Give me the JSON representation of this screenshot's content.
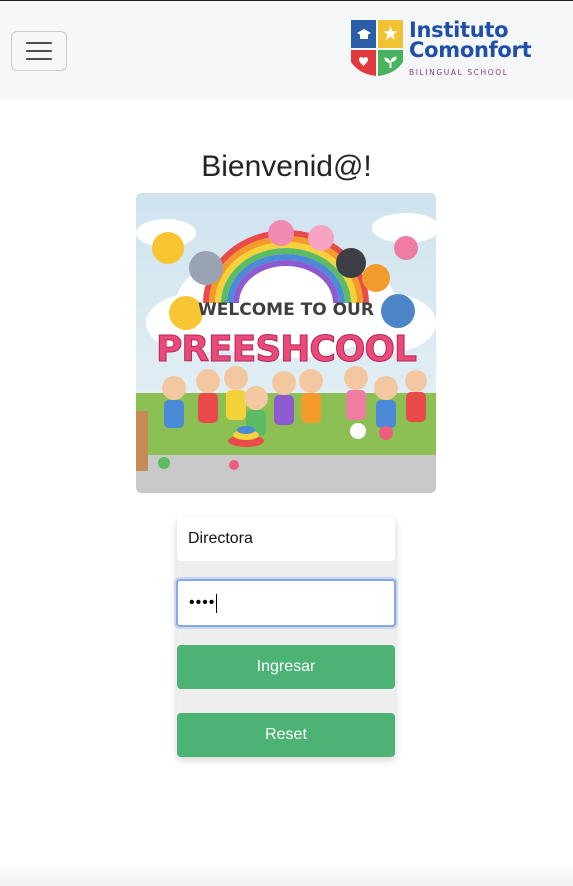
{
  "navbar": {
    "menu_toggle": "hamburger-icon",
    "logo": {
      "line1": "Instituto",
      "line2": "Comonfort",
      "tagline": "BILINGUAL SCHOOL",
      "colors": {
        "blue": "#2a5ea8",
        "yellow": "#f1c232",
        "red": "#e2393f",
        "green": "#47b35c",
        "text": "#1f4fa8",
        "tagline": "#8b3b7e"
      }
    }
  },
  "page": {
    "title": "Bienvenid@!",
    "banner": {
      "heading_top": "WELCOME TO OUR",
      "heading_main": "PREESHCOOL"
    }
  },
  "form": {
    "username_value": "Directora",
    "password_mask": "••••",
    "login_label": "Ingresar",
    "reset_label": "Reset"
  },
  "colors": {
    "accent": "#4cb375",
    "focus": "#86a8e4",
    "card": "#eeeeee"
  }
}
